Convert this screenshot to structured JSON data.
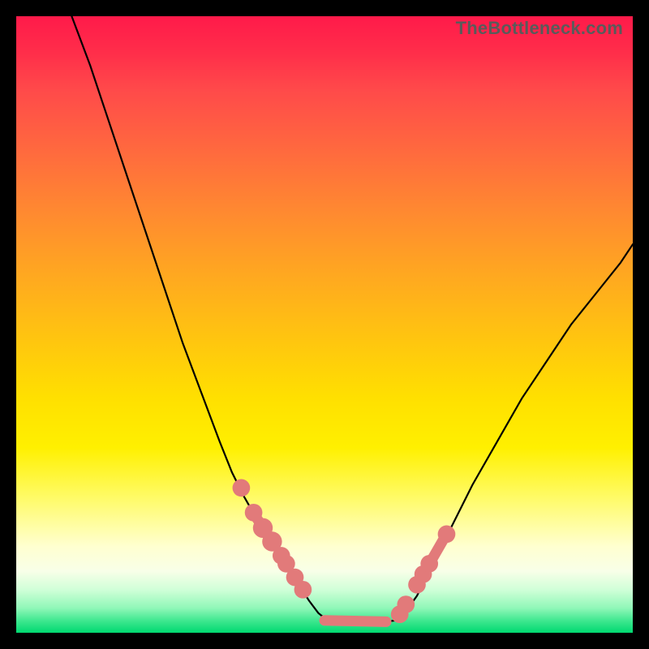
{
  "watermark": "TheBottleneck.com",
  "colors": {
    "frame": "#000000",
    "curve": "#000000",
    "marker": "#e27a7a",
    "gradient_top": "#ff1a4a",
    "gradient_mid": "#ffe000",
    "gradient_bottom": "#00d870"
  },
  "chart_data": {
    "type": "line",
    "title": "",
    "xlabel": "",
    "ylabel": "",
    "xlim": [
      0,
      100
    ],
    "ylim": [
      0,
      100
    ],
    "series": [
      {
        "name": "left-curve",
        "x": [
          9,
          12,
          15,
          18,
          21,
          24,
          27,
          30,
          33,
          35,
          37,
          39,
          41,
          43,
          44.5,
          46,
          47.5,
          49,
          50.5
        ],
        "y": [
          100,
          92,
          83,
          74,
          65,
          56,
          47,
          39,
          31,
          26,
          22,
          18.5,
          15.5,
          12.5,
          10,
          7.5,
          5.2,
          3.2,
          2
        ]
      },
      {
        "name": "valley-flat",
        "x": [
          50.5,
          52,
          54,
          56,
          58,
          60,
          61.5
        ],
        "y": [
          2,
          1.6,
          1.4,
          1.4,
          1.5,
          1.8,
          2
        ]
      },
      {
        "name": "right-curve",
        "x": [
          61.5,
          63,
          65,
          67,
          70,
          74,
          78,
          82,
          86,
          90,
          94,
          98,
          100
        ],
        "y": [
          2,
          3.2,
          6,
          10,
          16,
          24,
          31,
          38,
          44,
          50,
          55,
          60,
          63
        ]
      }
    ],
    "markers": {
      "name": "highlighted-points",
      "points": [
        {
          "x": 36.5,
          "y": 23.5,
          "r": 1.0
        },
        {
          "x": 38.5,
          "y": 19.5,
          "r": 1.0
        },
        {
          "x": 40.0,
          "y": 17.0,
          "r": 1.2
        },
        {
          "x": 41.5,
          "y": 14.8,
          "r": 1.2
        },
        {
          "x": 43.0,
          "y": 12.5,
          "r": 1.0
        },
        {
          "x": 43.8,
          "y": 11.2,
          "r": 1.0
        },
        {
          "x": 45.2,
          "y": 9.0,
          "r": 1.0
        },
        {
          "x": 46.5,
          "y": 7.0,
          "r": 1.0
        },
        {
          "x": 62.2,
          "y": 3.0,
          "r": 1.0
        },
        {
          "x": 63.2,
          "y": 4.6,
          "r": 1.0
        },
        {
          "x": 65.0,
          "y": 7.8,
          "r": 1.0
        },
        {
          "x": 66.0,
          "y": 9.5,
          "r": 1.0
        },
        {
          "x": 67.0,
          "y": 11.2,
          "r": 1.0
        },
        {
          "x": 69.8,
          "y": 16.0,
          "r": 1.0
        }
      ],
      "segments": [
        {
          "x1": 39.0,
          "y1": 18.6,
          "x2": 41.8,
          "y2": 14.4
        },
        {
          "x1": 50.0,
          "y1": 2.0,
          "x2": 60.0,
          "y2": 1.8
        },
        {
          "x1": 67.2,
          "y1": 11.5,
          "x2": 69.5,
          "y2": 15.5
        }
      ]
    }
  }
}
